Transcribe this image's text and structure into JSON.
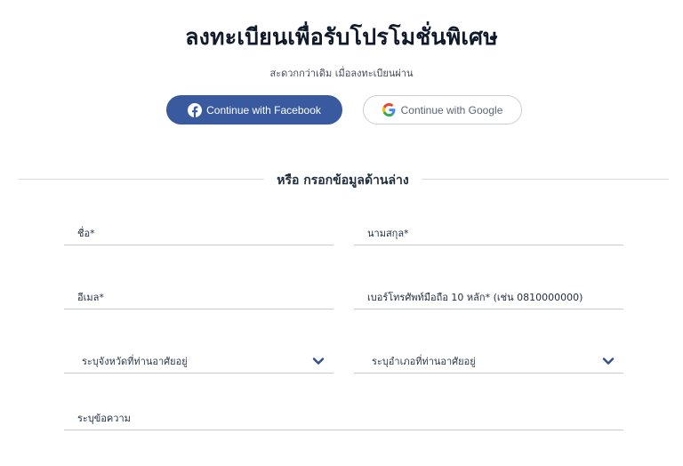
{
  "header": {
    "title": "ลงทะเบียนเพื่อรับโปรโมชั่นพิเศษ",
    "subtitle": "สะดวกกว่าเดิม เมื่อลงทะเบียนผ่าน"
  },
  "social": {
    "facebook_label": "Continue with Facebook",
    "google_label": "Continue with Google"
  },
  "divider": {
    "text": "หรือ กรอกข้อมูลด้านล่าง"
  },
  "form": {
    "name_label": "ชื่อ*",
    "surname_label": "นามสกุล*",
    "email_label": "อีเมล*",
    "phone_label": "เบอร์โทรศัพท์มือถือ 10 หลัก* (เช่น 0810000000)",
    "province_label": "ระบุจังหวัดที่ท่านอาศัยอยู่",
    "district_label": "ระบุอำเภอที่ท่านอาศัยอยู่",
    "message_label": "ระบุข้อความ"
  },
  "colors": {
    "facebook_blue": "#3a5aa0",
    "chevron_blue": "#2f4f8f",
    "title": "#111a2b"
  },
  "icons": {
    "facebook": "facebook-icon",
    "google": "google-icon",
    "dropdown": "chevron-down-icon"
  }
}
